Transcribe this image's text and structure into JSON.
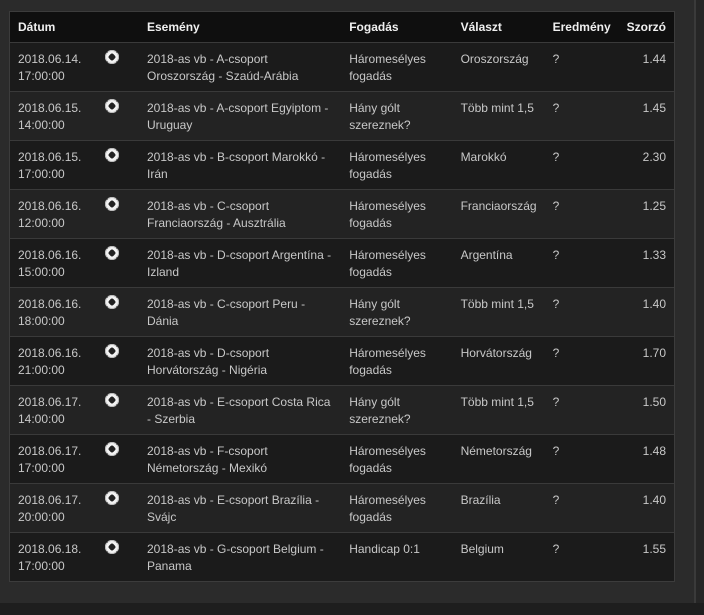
{
  "headers": {
    "date": "Dátum",
    "event": "Esemény",
    "bet": "Fogadás",
    "answer": "Választ",
    "result": "Eredmény",
    "odds": "Szorzó"
  },
  "icon": "soccer-ball-icon",
  "rows": [
    {
      "date": "2018.06.14.",
      "time": "17:00:00",
      "event": "2018-as vb - A-csoport Oroszország - Szaúd-Arábia",
      "bet": "Háromesélyes fogadás",
      "answer": "Oroszország",
      "result": "?",
      "odds": "1.44"
    },
    {
      "date": "2018.06.15.",
      "time": "14:00:00",
      "event": "2018-as vb - A-csoport Egyiptom - Uruguay",
      "bet": "Hány gólt szereznek?",
      "answer": "Több mint 1,5",
      "result": "?",
      "odds": "1.45"
    },
    {
      "date": "2018.06.15.",
      "time": "17:00:00",
      "event": "2018-as vb - B-csoport Marokkó - Irán",
      "bet": "Háromesélyes fogadás",
      "answer": "Marokkó",
      "result": "?",
      "odds": "2.30"
    },
    {
      "date": "2018.06.16.",
      "time": "12:00:00",
      "event": "2018-as vb - C-csoport Franciaország - Ausztrália",
      "bet": "Háromesélyes fogadás",
      "answer": "Franciaország",
      "result": "?",
      "odds": "1.25"
    },
    {
      "date": "2018.06.16.",
      "time": "15:00:00",
      "event": "2018-as vb - D-csoport Argentína - Izland",
      "bet": "Háromesélyes fogadás",
      "answer": "Argentína",
      "result": "?",
      "odds": "1.33"
    },
    {
      "date": "2018.06.16.",
      "time": "18:00:00",
      "event": "2018-as vb - C-csoport Peru - Dánia",
      "bet": "Hány gólt szereznek?",
      "answer": "Több mint 1,5",
      "result": "?",
      "odds": "1.40"
    },
    {
      "date": "2018.06.16.",
      "time": "21:00:00",
      "event": "2018-as vb - D-csoport Horvátország - Nigéria",
      "bet": "Háromesélyes fogadás",
      "answer": "Horvátország",
      "result": "?",
      "odds": "1.70"
    },
    {
      "date": "2018.06.17.",
      "time": "14:00:00",
      "event": "2018-as vb - E-csoport Costa Rica - Szerbia",
      "bet": "Hány gólt szereznek?",
      "answer": "Több mint 1,5",
      "result": "?",
      "odds": "1.50"
    },
    {
      "date": "2018.06.17.",
      "time": "17:00:00",
      "event": "2018-as vb - F-csoport Németország - Mexikó",
      "bet": "Háromesélyes fogadás",
      "answer": "Németország",
      "result": "?",
      "odds": "1.48"
    },
    {
      "date": "2018.06.17.",
      "time": "20:00:00",
      "event": "2018-as vb - E-csoport Brazília - Svájc",
      "bet": "Háromesélyes fogadás",
      "answer": "Brazília",
      "result": "?",
      "odds": "1.40"
    },
    {
      "date": "2018.06.18.",
      "time": "17:00:00",
      "event": "2018-as vb - G-csoport Belgium - Panama",
      "bet": "Handicap 0:1",
      "answer": "Belgium",
      "result": "?",
      "odds": "1.55"
    }
  ]
}
